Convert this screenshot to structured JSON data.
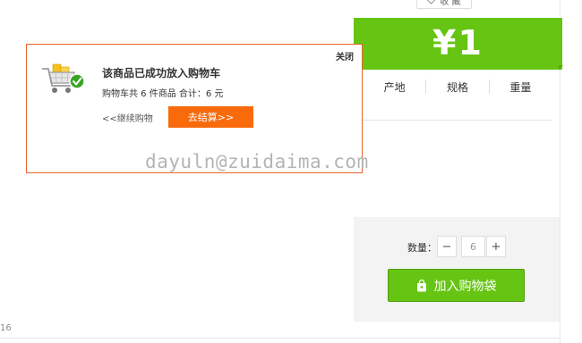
{
  "header": {
    "collect_label": "收 藏",
    "collect_icon": "heart-icon"
  },
  "product": {
    "price": "¥1",
    "tabs": [
      "产地",
      "规格",
      "重量"
    ],
    "quantity_label": "数量：",
    "quantity_value": "6",
    "minus": "−",
    "plus": "+",
    "add_to_bag_label": "加入购物袋",
    "bag_icon": "shopping-bag-icon"
  },
  "popup": {
    "close_label": "关闭",
    "cart_icon": "cart-success-icon",
    "title": "该商品已成功放入购物车",
    "summary": "购物车共 6 件商品  合计：6 元",
    "continue_label": "<<继续购物",
    "checkout_label": "去结算>>"
  },
  "footer": {
    "page_number": "16"
  },
  "watermark": "dayuln@zuidaima.com",
  "colors": {
    "accent_green": "#66c413",
    "checkout_orange": "#f96a0b",
    "popup_border": "#e8642b"
  }
}
